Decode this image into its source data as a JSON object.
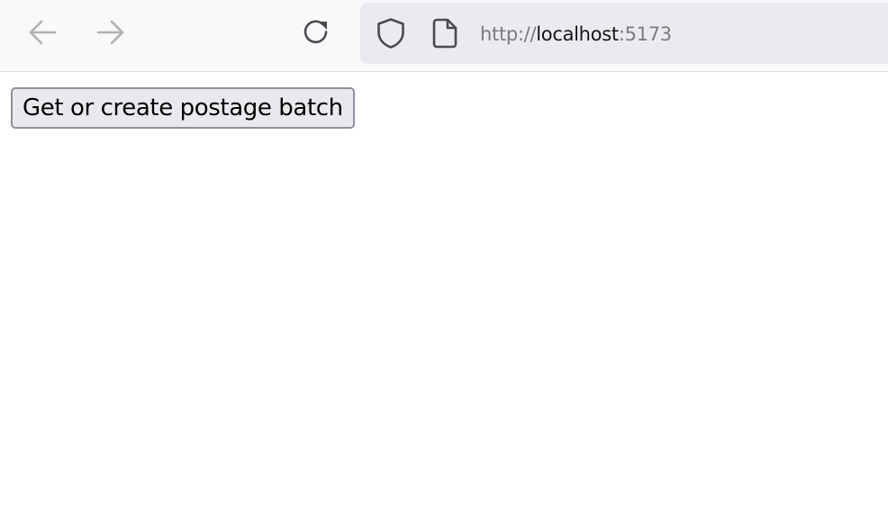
{
  "browser": {
    "url": {
      "scheme": "http://",
      "host": "localhost",
      "port": ":5173"
    },
    "icons": {
      "back": "arrow-left-icon",
      "forward": "arrow-right-icon",
      "reload": "reload-icon",
      "tracking_protection": "shield-icon",
      "page": "page-icon"
    },
    "colors": {
      "toolbar_bg": "#f9f9fb",
      "urlbar_bg": "#ebebef",
      "disabled_icon": "#b1b1b3",
      "icon": "#4a4a4f"
    }
  },
  "page": {
    "button_label": "Get or create postage batch",
    "colors": {
      "button_bg": "#e9e9ed",
      "button_border": "#8f8f9d"
    }
  }
}
